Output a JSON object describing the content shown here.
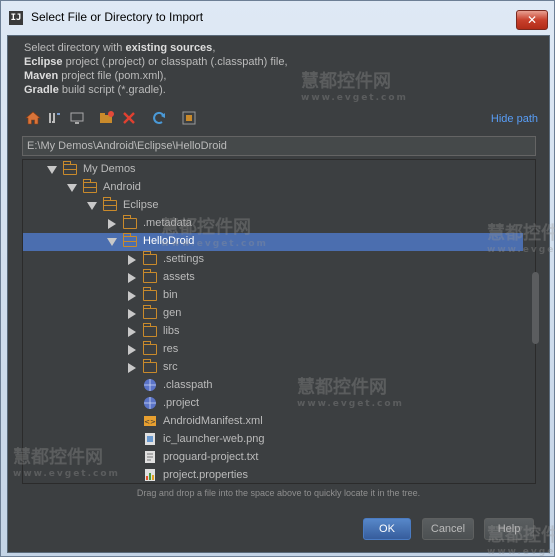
{
  "window": {
    "title": "Select File or Directory to Import",
    "close_glyph": "✕",
    "app_icon": "IJ"
  },
  "description": {
    "line1_pre": "Select directory with ",
    "line1_bold": "existing sources",
    "line1_post": ",",
    "line2_bold": "Eclipse",
    "line2_post": " project (.project) or classpath (.classpath) file,",
    "line3_bold": "Maven",
    "line3_post": " project file (pom.xml),",
    "line4_bold": "Gradle",
    "line4_post": " build script (*.gradle)."
  },
  "toolbar": {
    "icons": [
      "home-icon",
      "project-icon",
      "desktop-icon",
      "new-folder-icon",
      "delete-icon",
      "refresh-icon",
      "show-hidden-icon"
    ],
    "hide_path": "Hide path"
  },
  "path": {
    "value": "E:\\My Demos\\Android\\Eclipse\\HelloDroid"
  },
  "tree": {
    "rows": [
      {
        "label": "My Demos",
        "depth": 0,
        "kind": "folder",
        "expand": "down",
        "selected": false
      },
      {
        "label": "Android",
        "depth": 1,
        "kind": "folder",
        "expand": "down",
        "selected": false
      },
      {
        "label": "Eclipse",
        "depth": 2,
        "kind": "folder",
        "expand": "down",
        "selected": false
      },
      {
        "label": ".metadata",
        "depth": 3,
        "kind": "folder",
        "expand": "right",
        "selected": false
      },
      {
        "label": "HelloDroid",
        "depth": 3,
        "kind": "folder",
        "expand": "down",
        "selected": true
      },
      {
        "label": ".settings",
        "depth": 4,
        "kind": "folder",
        "expand": "right",
        "selected": false
      },
      {
        "label": "assets",
        "depth": 4,
        "kind": "folder",
        "expand": "right",
        "selected": false
      },
      {
        "label": "bin",
        "depth": 4,
        "kind": "folder",
        "expand": "right",
        "selected": false
      },
      {
        "label": "gen",
        "depth": 4,
        "kind": "folder",
        "expand": "right",
        "selected": false
      },
      {
        "label": "libs",
        "depth": 4,
        "kind": "folder",
        "expand": "right",
        "selected": false
      },
      {
        "label": "res",
        "depth": 4,
        "kind": "folder",
        "expand": "right",
        "selected": false
      },
      {
        "label": "src",
        "depth": 4,
        "kind": "folder",
        "expand": "right",
        "selected": false
      },
      {
        "label": ".classpath",
        "depth": 4,
        "kind": "globe-file",
        "expand": "none",
        "selected": false
      },
      {
        "label": ".project",
        "depth": 4,
        "kind": "globe-file",
        "expand": "none",
        "selected": false
      },
      {
        "label": "AndroidManifest.xml",
        "depth": 4,
        "kind": "xml-file",
        "expand": "none",
        "selected": false
      },
      {
        "label": "ic_launcher-web.png",
        "depth": 4,
        "kind": "image-file",
        "expand": "none",
        "selected": false
      },
      {
        "label": "proguard-project.txt",
        "depth": 4,
        "kind": "text-file",
        "expand": "none",
        "selected": false
      },
      {
        "label": "project.properties",
        "depth": 4,
        "kind": "properties-file",
        "expand": "none",
        "selected": false
      }
    ]
  },
  "hint": "Drag and drop a file into the space above to quickly locate it in the tree.",
  "buttons": {
    "ok": "OK",
    "cancel": "Cancel",
    "help": "Help"
  },
  "watermark": {
    "cn": "慧都控件网",
    "url": "www.evget.com"
  },
  "colors": {
    "background": "#3c3f41",
    "selection": "#4b6eaf",
    "link": "#589df6",
    "folder": "#c98a2b"
  }
}
